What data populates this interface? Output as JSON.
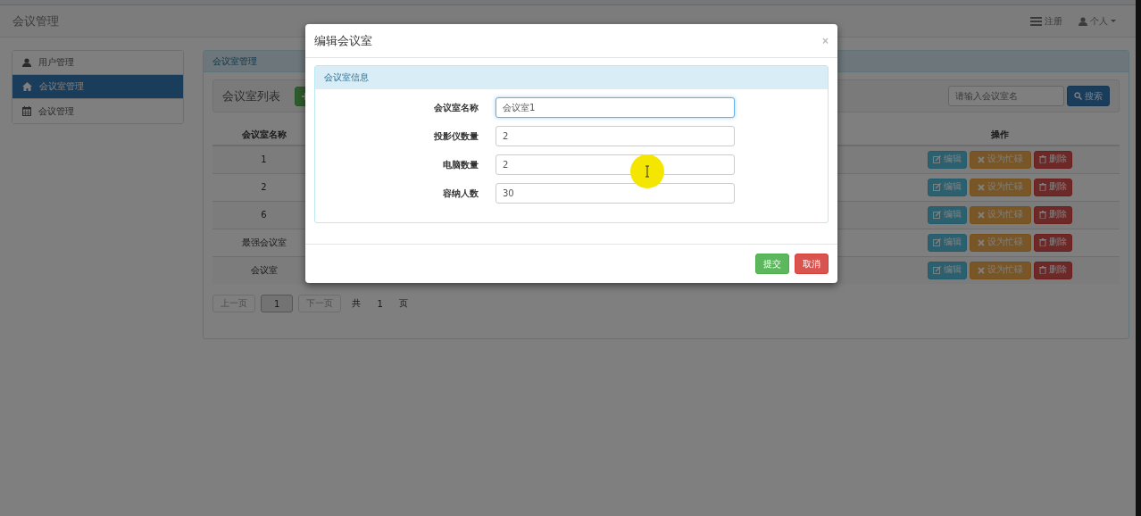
{
  "navbar": {
    "brand": "会议管理",
    "links": [
      {
        "kind": "register",
        "label": "注册"
      },
      {
        "kind": "user",
        "label": "个人",
        "dropdown": true
      }
    ]
  },
  "sidebar": {
    "items": [
      {
        "kind": "user",
        "label": "用户管理",
        "selected": false
      },
      {
        "kind": "home",
        "label": "会议室管理",
        "selected": true
      },
      {
        "kind": "calendar",
        "label": "会议管理",
        "selected": false
      }
    ]
  },
  "panel": {
    "title": "会议室管理",
    "list_title": "会议室列表",
    "search": {
      "placeholder": "请输入会议室名",
      "button": "搜索"
    },
    "table": {
      "columns": [
        "会议室名称",
        "操作"
      ],
      "rows": [
        {
          "name": "1",
          "actions": [
            "编辑",
            "设为忙碌",
            "删除"
          ]
        },
        {
          "name": "2",
          "actions": [
            "编辑",
            "设为忙碌",
            "删除"
          ]
        },
        {
          "name": "6",
          "actions": [
            "编辑",
            "设为忙碌",
            "删除"
          ]
        },
        {
          "name": "最强会议室",
          "actions": [
            "编辑",
            "设为忙碌",
            "删除"
          ]
        },
        {
          "name": "会议室",
          "actions": [
            "编辑",
            "设为忙碌",
            "删除"
          ]
        }
      ]
    },
    "pagination": {
      "prev": "上一页",
      "pages": [
        {
          "label": "1",
          "selected": true
        }
      ],
      "next": "下一页",
      "total_prefix": "共",
      "total": "1",
      "total_suffix": "页"
    }
  },
  "modal": {
    "title": "编辑会议室",
    "close": "×",
    "section_title": "会议室信息",
    "fields": [
      {
        "label": "会议室名称",
        "value": "会议室1",
        "focused": true
      },
      {
        "label": "投影仪数量",
        "value": "2",
        "focused": false
      },
      {
        "label": "电脑数量",
        "value": "2",
        "focused": false
      },
      {
        "label": "容纳人数",
        "value": "30",
        "focused": false
      }
    ],
    "buttons": [
      {
        "kind": "submit",
        "label": "提交"
      },
      {
        "kind": "cancel",
        "label": "取消"
      }
    ]
  }
}
